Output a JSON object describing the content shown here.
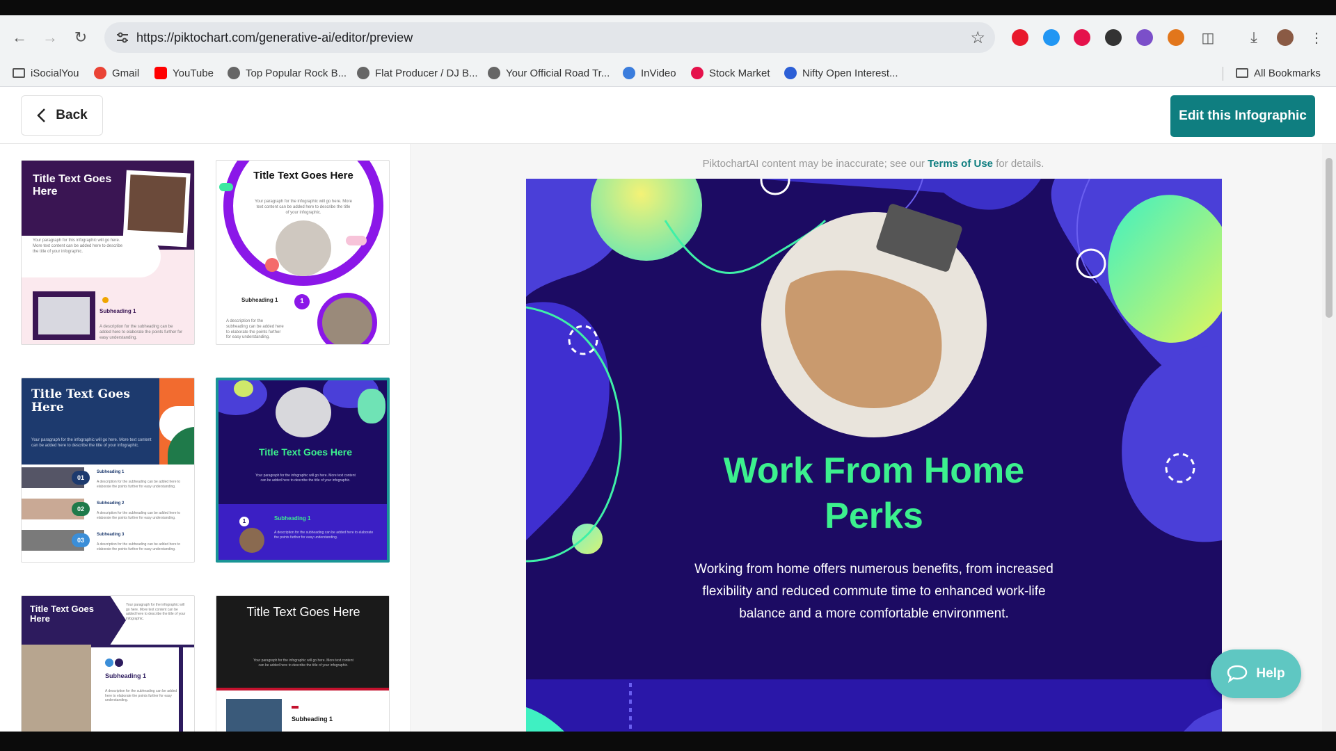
{
  "browser": {
    "url": "https://piktochart.com/generative-ai/editor/preview",
    "bookmarks": [
      "iSocialYou",
      "Gmail",
      "YouTube",
      "Top Popular Rock B...",
      "Flat Producer / DJ B...",
      "Your Official Road Tr...",
      "InVideo",
      "Stock Market",
      "Nifty Open Interest..."
    ],
    "all_bookmarks": "All Bookmarks",
    "extension_colors": [
      "#e8192c",
      "#2196f3",
      "#e5114b",
      "#333333",
      "#7b4fc9",
      "#e2761b",
      "#555555"
    ]
  },
  "header": {
    "back_label": "Back",
    "edit_label": "Edit this Infographic"
  },
  "thumbnails": {
    "t1": {
      "title": "Title Text Goes Here",
      "paragraph": "Your paragraph for this infographic will go here. More text content can be added here to describe the title of your infographic.",
      "subheading": "Subheading 1",
      "desc": "A description for the subheading can be added here to elaborate the points further for easy understanding."
    },
    "t2": {
      "title": "Title Text Goes Here",
      "paragraph": "Your paragraph for the infographic will go here. More text content can be added here to describe the title of your infographic.",
      "subheading": "Subheading 1",
      "number": "1",
      "desc": "A description for the subheading can be added here to elaborate the points further for easy understanding."
    },
    "t3": {
      "title": "Title Text Goes Here",
      "paragraph": "Your paragraph for the infographic will go here. More text content can be added here to describe the title of your infographic.",
      "rows": [
        {
          "num": "01",
          "sub": "Subheading 1",
          "desc": "A description for the subheading can be added here to elaborate the points further for easy understanding."
        },
        {
          "num": "02",
          "sub": "Subheading 2",
          "desc": "A description for the subheading can be added here to elaborate the points further for easy understanding."
        },
        {
          "num": "03",
          "sub": "Subheading 3",
          "desc": "A description for the subheading can be added here to elaborate the points further for easy understanding."
        }
      ]
    },
    "t4": {
      "title": "Title Text Goes Here",
      "paragraph": "Your paragraph for the infographic will go here. More text content can be added here to describe the title of your infographic.",
      "subheading": "Subheading 1",
      "number": "1",
      "desc": "A description for the subheading can be added here to elaborate the points further for easy understanding."
    },
    "t5": {
      "title": "Title Text Goes Here",
      "paragraph": "Your paragraph for the infographic will go here. More text content can be added here to describe the title of your infographic.",
      "subheading": "Subheading 1",
      "desc": "A description for the subheading can be added here to elaborate the points further for easy understanding."
    },
    "t6": {
      "title": "Title Text Goes Here",
      "paragraph": "Your paragraph for the infographic will go here. More text content can be added here to describe the title of your infographic.",
      "subheading": "Subheading 1"
    }
  },
  "preview": {
    "disclaimer_pre": "PiktochartAI content may be inaccurate; see our ",
    "disclaimer_link": "Terms of Use",
    "disclaimer_post": " for details.",
    "headline_line1": "Work From Home",
    "headline_line2": "Perks",
    "body": "Working from home offers numerous benefits, from increased flexibility and reduced commute time to enhanced work-life balance and a more comfortable environment."
  },
  "help_label": "Help",
  "accent_color": "#0f7e80",
  "headline_color": "#3cf08e",
  "canvas_bg": "#1c0b63"
}
